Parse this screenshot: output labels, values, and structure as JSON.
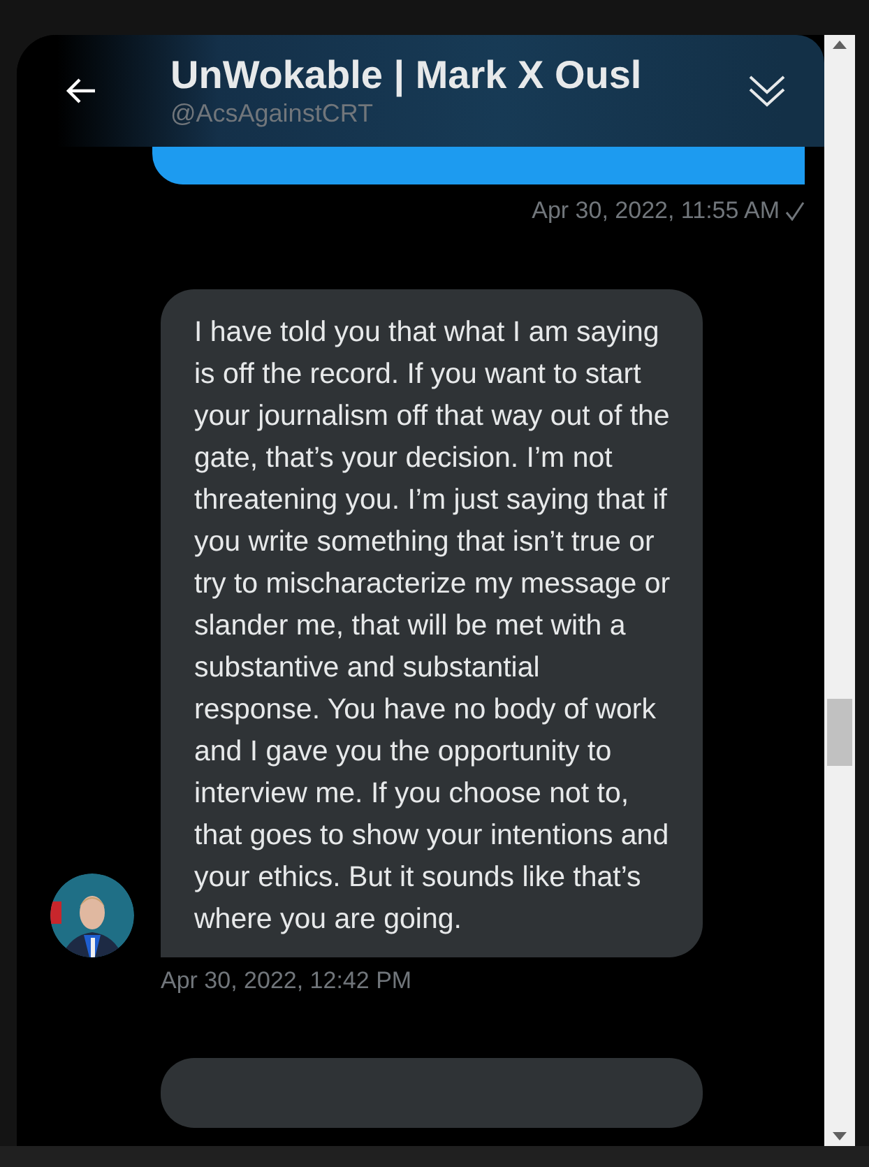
{
  "header": {
    "title": "UnWokable | Mark X Ousl",
    "handle": "@AcsAgainstCRT"
  },
  "messages": [
    {
      "kind": "sent",
      "time": "Apr 30, 2022, 11:55 AM",
      "read": true
    },
    {
      "kind": "received",
      "text": "I have told you that what I am saying is off the record. If you want to start your journalism off that way out of the gate, that’s your decision. I’m not threatening you. I’m just saying that if you write something that isn’t true or try to mischaracterize my message or slander me, that will be met with a substantive and substantial response. You have no body of work and I gave you the opportunity to interview me. If you choose not to, that goes to show your intentions and your ethics. But it sounds like that’s where you are going.",
      "time": "Apr 30, 2022, 12:42 PM",
      "avatar": true
    },
    {
      "kind": "received"
    }
  ]
}
